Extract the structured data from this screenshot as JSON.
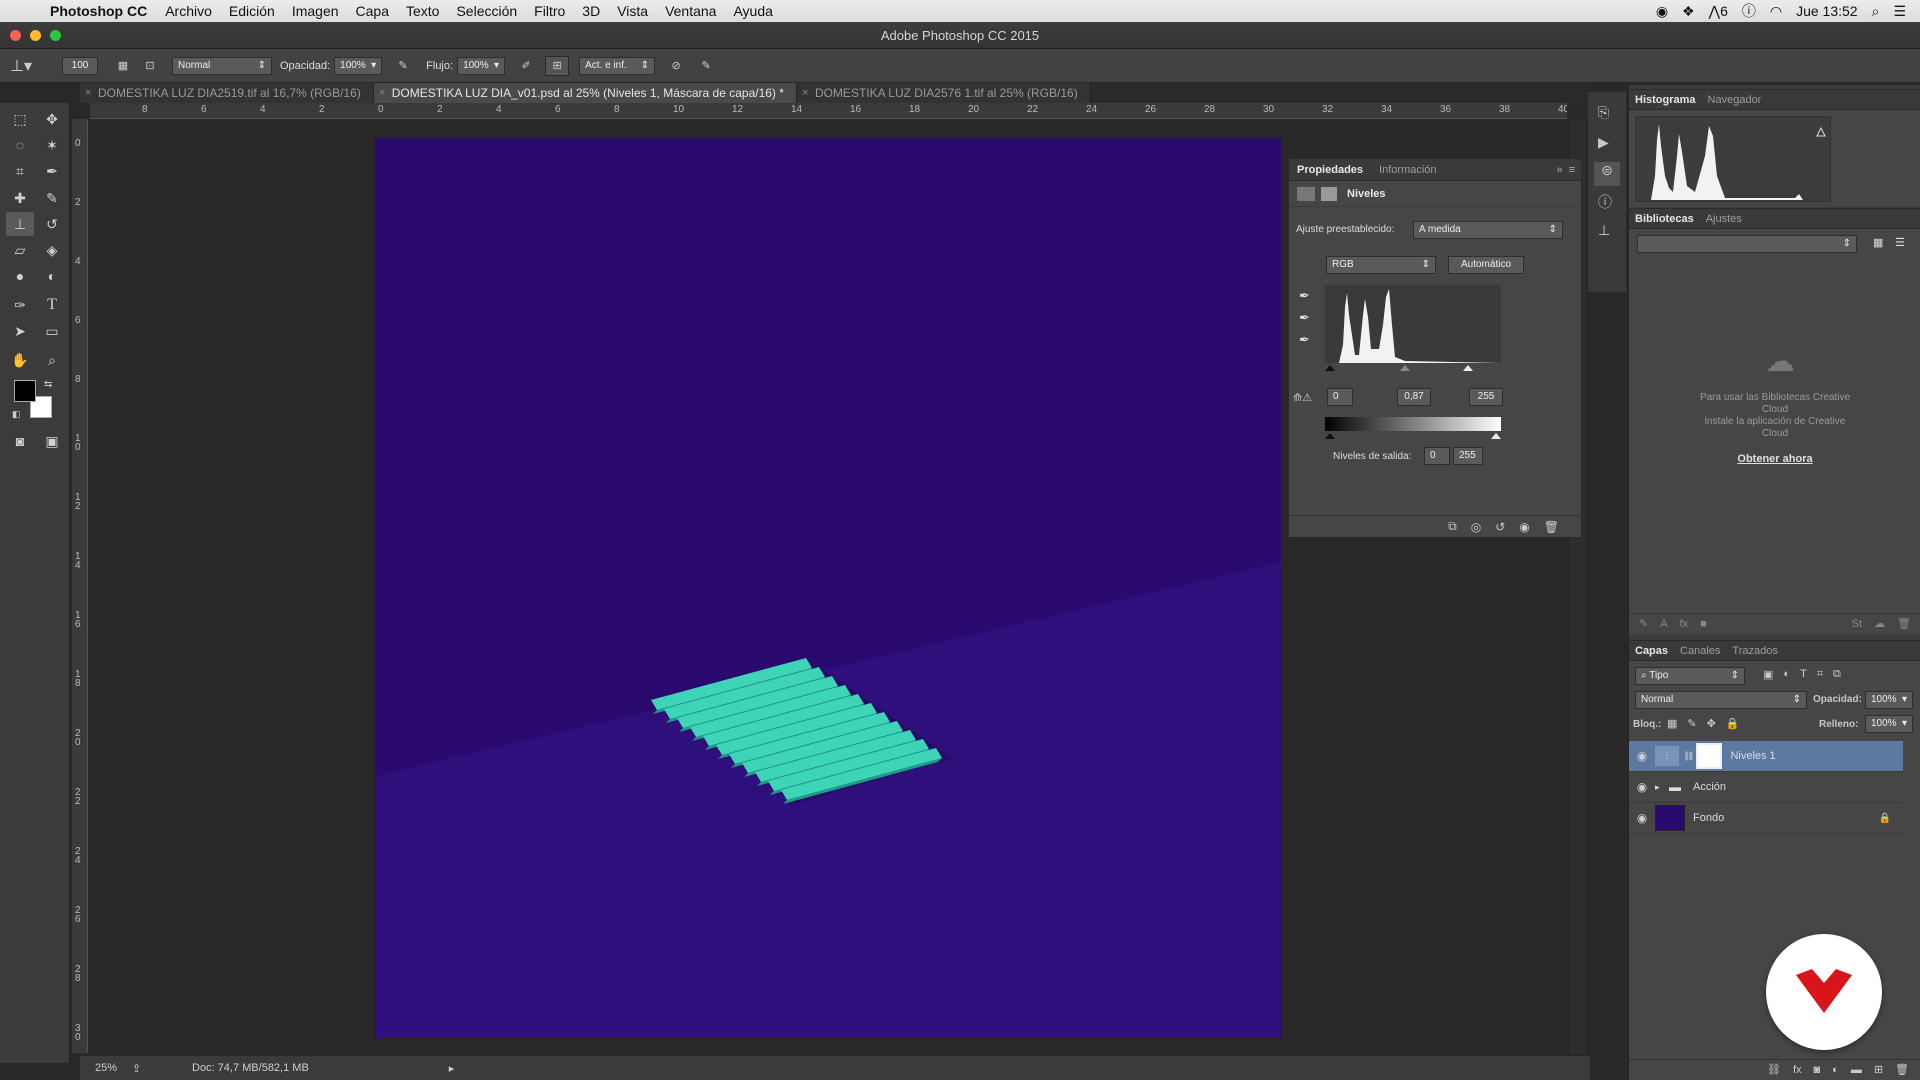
{
  "menubar": {
    "app_name": "Photoshop CC",
    "items": [
      "Archivo",
      "Edición",
      "Imagen",
      "Capa",
      "Texto",
      "Selección",
      "Filtro",
      "3D",
      "Vista",
      "Ventana",
      "Ayuda"
    ],
    "status_badge": "6",
    "clock": "Jue 13:52"
  },
  "window": {
    "title": "Adobe Photoshop CC 2015"
  },
  "options": {
    "brush_size": "100",
    "mode_label": "Normal",
    "opacity_label": "Opacidad:",
    "opacity_value": "100%",
    "flow_label": "Flujo:",
    "flow_value": "100%",
    "sample_label": "Act. e inf."
  },
  "tabs": [
    {
      "label": "DOMESTIKA LUZ DIA2519.tif al 16,7% (RGB/16)"
    },
    {
      "label": "DOMESTIKA LUZ DIA_v01.psd al 25% (Niveles 1, Máscara de capa/16) *"
    },
    {
      "label": "DOMESTIKA LUZ DIA2576 1.tif al 25% (RGB/16)"
    }
  ],
  "ruler": {
    "h_labels": [
      "8",
      "6",
      "4",
      "2",
      "0",
      "2",
      "4",
      "6",
      "8",
      "10",
      "12",
      "14",
      "16",
      "18",
      "20",
      "22",
      "24",
      "26",
      "28",
      "30",
      "32",
      "34",
      "36",
      "38",
      "40"
    ],
    "v_labels": [
      "0",
      "2",
      "4",
      "6",
      "8",
      "10",
      "12",
      "14",
      "16",
      "18",
      "20",
      "22",
      "24",
      "26",
      "28",
      "30"
    ]
  },
  "status": {
    "zoom": "25%",
    "doc": "Doc: 74,7 MB/582,1 MB"
  },
  "properties": {
    "tab_active": "Propiedades",
    "tab_other": "Información",
    "panel_title": "Niveles",
    "preset_label": "Ajuste preestablecido:",
    "preset_value": "A medida",
    "channel": "RGB",
    "auto_button": "Automático",
    "input_black": "0",
    "input_gamma": "0,87",
    "input_white": "255",
    "output_label": "Niveles de salida:",
    "output_black": "0",
    "output_white": "255"
  },
  "histogram": {
    "tab_active": "Histograma",
    "tab_other": "Navegador"
  },
  "libraries": {
    "tab_active": "Bibliotecas",
    "tab_other": "Ajustes",
    "message_line1": "Para usar las Bibliotecas Creative",
    "message_line2": "Cloud",
    "message_line3": "instale la aplicación de Creative",
    "message_line4": "Cloud",
    "link": "Obtener ahora"
  },
  "layers_panel": {
    "tab_active": "Capas",
    "tab_channels": "Canales",
    "tab_paths": "Trazados",
    "filter_label": "Tipo",
    "blend_mode": "Normal",
    "opacity_label": "Opacidad:",
    "opacity_value": "100%",
    "lock_label": "Bloq.:",
    "fill_label": "Relleno:",
    "fill_value": "100%",
    "layers": [
      {
        "name": "Niveles 1"
      },
      {
        "name": "Acción"
      },
      {
        "name": "Fondo"
      }
    ]
  },
  "colors": {
    "artwork_bg": "#2a0a6e",
    "artwork_floor": "#2e0f7c",
    "object": "#3dd4b8",
    "selection": "#5c7aa1",
    "badge_red": "#d8151b"
  }
}
